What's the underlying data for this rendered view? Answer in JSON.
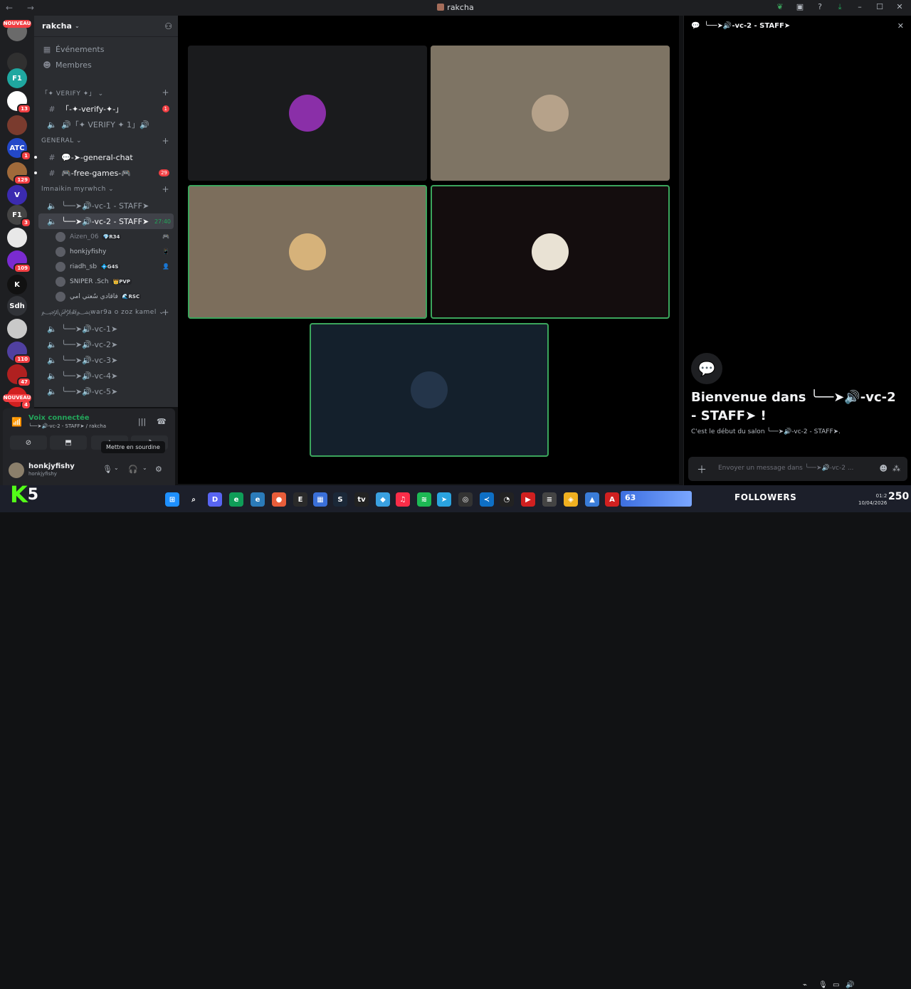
{
  "window": {
    "title": "rakcha"
  },
  "servers": {
    "new_label": "NOUVEAU",
    "items": [
      {
        "label": "",
        "color": "#6a6a6a"
      },
      {
        "label": "",
        "color": "#303030"
      },
      {
        "label": "F1",
        "color": "#1fa7a0"
      },
      {
        "label": "",
        "color": "#ffffff",
        "badge": "13"
      },
      {
        "label": "",
        "color": "#7a3b2e"
      },
      {
        "label": "ATC",
        "color": "#2348c8",
        "badge": "1"
      },
      {
        "label": "",
        "color": "#a06a3a",
        "badge": "129"
      },
      {
        "label": "V",
        "color": "#3b2bb0"
      },
      {
        "label": "F1",
        "color": "#444",
        "badge": "3"
      },
      {
        "label": "",
        "color": "#e8e8e8"
      },
      {
        "label": "",
        "color": "#7a2bd0",
        "badge": "109"
      },
      {
        "label": "K",
        "color": "#111",
        "badge": ""
      },
      {
        "label": "Sdh",
        "color": "#313338"
      },
      {
        "label": "",
        "color": "#c9c9c9"
      },
      {
        "label": "",
        "color": "#5040a0",
        "badge": "110"
      },
      {
        "label": "",
        "color": "#b02020",
        "badge": "47"
      },
      {
        "label": "",
        "color": "#d02020",
        "badge": "4"
      }
    ]
  },
  "sidebar": {
    "server_name": "rakcha",
    "nav": [
      {
        "label": "Événements",
        "icon": "calendar-icon"
      },
      {
        "label": "Membres",
        "icon": "members-icon"
      }
    ],
    "categories": [
      {
        "name": "「✦ VERIFY ✦」",
        "channels": [
          {
            "type": "text",
            "name": "「-✦-verify-✦-」",
            "badge": "1",
            "bright": true
          },
          {
            "type": "voice",
            "name": "🔊「✦ VERIFY ✦ 1」🔊"
          }
        ]
      },
      {
        "name": "GENERAL",
        "channels": [
          {
            "type": "text",
            "name": "💬-➤-general-chat",
            "bright": true,
            "unread": true
          },
          {
            "type": "text",
            "name": "🎮-free-games-🎮",
            "badge": "29",
            "bright": true,
            "unread": true
          }
        ]
      },
      {
        "name": "lmnaikin myrwhch",
        "channels": [
          {
            "type": "voice",
            "name": "╰──➤🔊-vc-1 - STAFF➤"
          },
          {
            "type": "voice",
            "name": "╰──➤🔊-vc-2 - STAFF➤",
            "active": true,
            "timer": "27:40"
          }
        ]
      }
    ],
    "voice_users": [
      {
        "name": "Aizen_06",
        "tag": "💎R34",
        "dim": true,
        "icon": "🎮"
      },
      {
        "name": "honkjyfishy",
        "tag": "",
        "dim": false,
        "icon": "📱"
      },
      {
        "name": "riadh_sb",
        "tag": "💠G4S",
        "dim": false,
        "icon": "👤"
      },
      {
        "name": "SNIPER .Sch",
        "tag": "👑PVP",
        "dim": false,
        "icon": ""
      },
      {
        "name": "فاقادي سُعتي امي",
        "tag": "🌊RSC",
        "dim": false,
        "icon": ""
      }
    ],
    "category4": {
      "name": "﷽war9a o zoz kamel",
      "channels": [
        "╰──➤🔊-vc-1➤",
        "╰──➤🔊-vc-2➤",
        "╰──➤🔊-vc-3➤",
        "╰──➤🔊-vc-4➤",
        "╰──➤🔊-vc-5➤"
      ]
    }
  },
  "voice_panel": {
    "status": "Voix connectée",
    "sub": "╰──➤🔊-vc-2 - STAFF➤ / rakcha",
    "tooltip": "Mettre en sourdine"
  },
  "user": {
    "name": "honkjyfishy",
    "status": "honkjyfishy"
  },
  "stage": {
    "tiles": [
      {
        "bg": "#1a1b1d",
        "avatar": "#8a2fa8",
        "speaking": false
      },
      {
        "bg": "#7e7464",
        "avatar": "#b6a28a",
        "speaking": false
      },
      {
        "bg": "#7c6e5c",
        "avatar": "#d6b27a",
        "speaking": true
      },
      {
        "bg": "#140d0e",
        "avatar": "#e9e2d4",
        "speaking": true
      },
      {
        "bg": "#14202c",
        "avatar": "#24354a",
        "speaking": true
      }
    ]
  },
  "chat": {
    "header": "╰──➤🔊-vc-2 - STAFF➤",
    "welcome": "Bienvenue dans ╰──➤🔊-vc-2 - STAFF➤ !",
    "welcome_sub": "C'est le début du salon ╰──➤🔊-vc-2 - STAFF➤.",
    "placeholder": "Envoyer un message dans ╰──➤🔊-vc-2 ..."
  },
  "overlay": {
    "k5_letter": "K",
    "k5_number": "5",
    "viewers": "63",
    "followers_label": "FOLLOWERS",
    "followers_count": "250",
    "clock_time": "01:2",
    "clock_date": "10/04/2026"
  }
}
